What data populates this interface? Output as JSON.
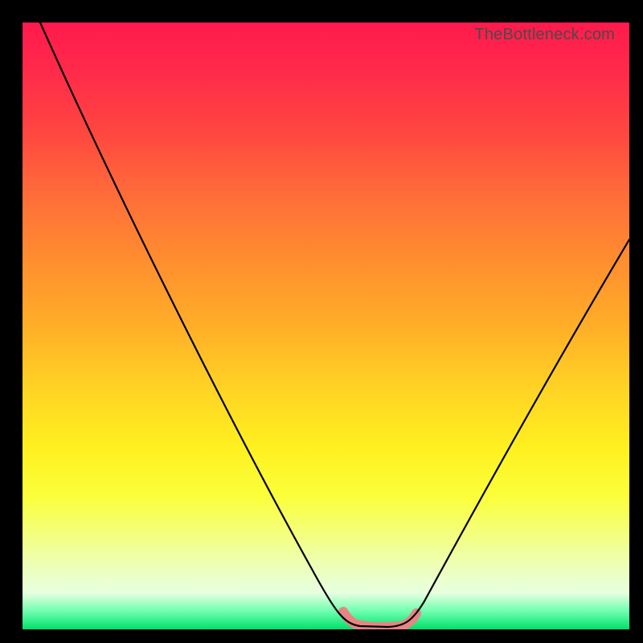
{
  "watermark": "TheBottleneck.com",
  "chart_data": {
    "type": "line",
    "title": "",
    "xlabel": "",
    "ylabel": "",
    "xlim": [
      0,
      100
    ],
    "ylim": [
      0,
      100
    ],
    "series": [
      {
        "name": "curve",
        "x": [
          3,
          10,
          20,
          30,
          40,
          48,
          52,
          55,
          58,
          61,
          63,
          65,
          72,
          80,
          88,
          95,
          100
        ],
        "y": [
          100,
          86,
          68,
          50,
          32,
          14,
          5,
          1,
          0,
          0,
          1,
          4,
          14,
          28,
          42,
          55,
          64
        ]
      }
    ],
    "highlight": {
      "name": "optimal-range",
      "x_start": 53,
      "x_end": 65,
      "color": "#e98484"
    }
  }
}
